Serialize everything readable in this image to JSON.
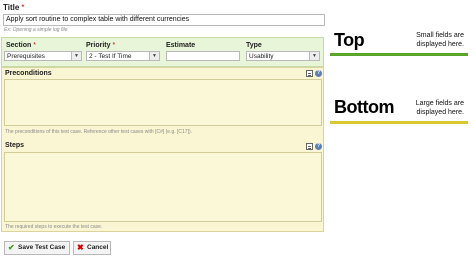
{
  "form": {
    "title_label": "Title",
    "required_marker": "*",
    "title_value": "Apply sort routine to complex table with different currencies",
    "title_hint": "Ex: Opening a simple log file",
    "section": {
      "label": "Section",
      "required_marker": "*",
      "value": "Prerequisites"
    },
    "priority": {
      "label": "Priority",
      "required_marker": "*",
      "value": "2 - Test If Time"
    },
    "estimate": {
      "label": "Estimate",
      "value": ""
    },
    "type": {
      "label": "Type",
      "value": "Usability"
    },
    "preconditions": {
      "label": "Preconditions",
      "description": "The preconditions of this test case. Reference other test cases with [C#] (e.g. [C17])."
    },
    "steps": {
      "label": "Steps",
      "description": "The required steps to execute the test case."
    },
    "save_label": "Save Test Case",
    "cancel_label": "Cancel"
  },
  "annotations": {
    "top": {
      "heading": "Top",
      "line1": "Small fields are",
      "line2": "displayed here."
    },
    "bottom": {
      "heading": "Bottom",
      "line1": "Large fields are",
      "line2": "displayed here."
    }
  },
  "colors": {
    "top_band": "#e8f5d8",
    "bottom_band": "#faf5d2",
    "top_line": "#5aa52c",
    "bottom_line": "#d8c832",
    "required": "#d40000"
  },
  "icons": [
    "chevron-down-icon",
    "grid-icon",
    "help-icon",
    "check-icon",
    "cross-icon"
  ]
}
